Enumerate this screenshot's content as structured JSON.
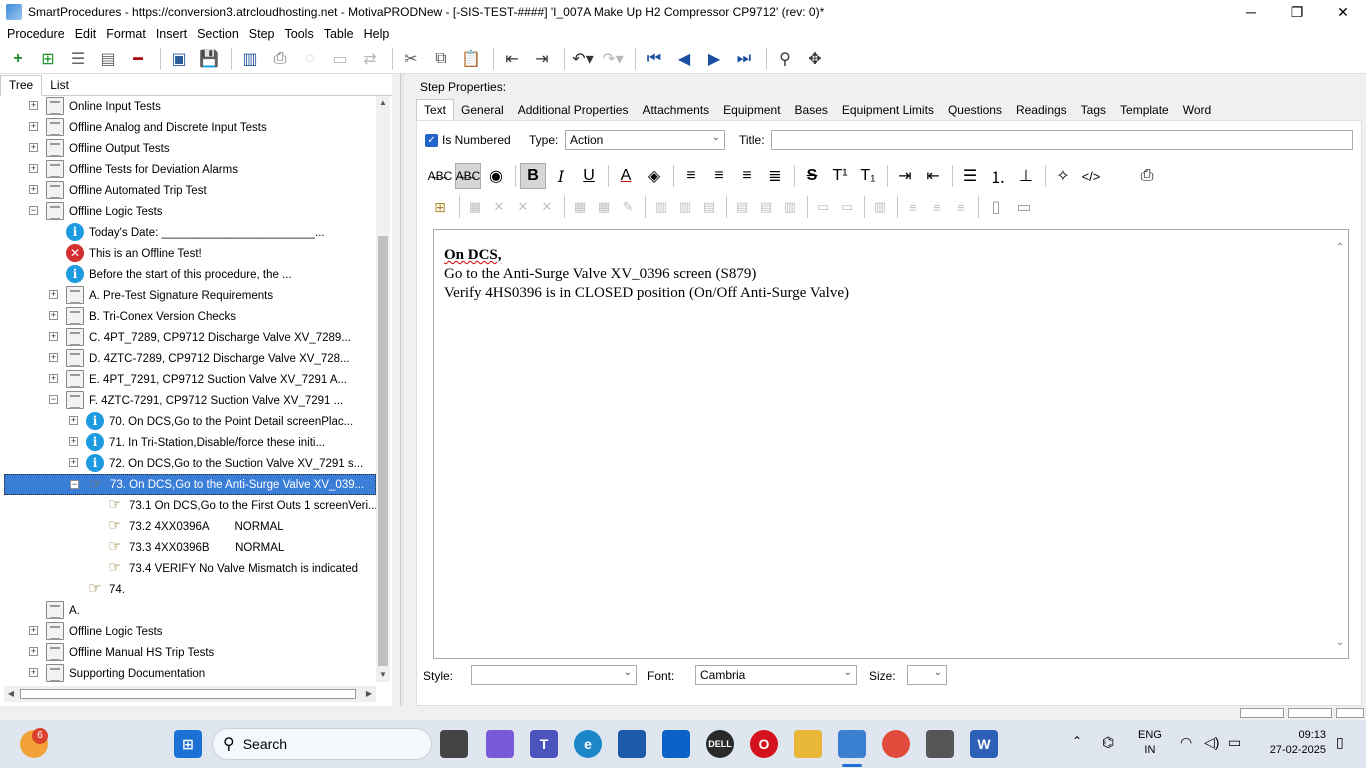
{
  "window": {
    "title": "SmartProcedures - https://conversion3.atrcloudhosting.net - MotivaPRODNew - [-SIS-TEST-####] 'I_007A Make Up H2 Compressor CP9712' (rev: 0)*",
    "minimize": "─",
    "maximize": "❐",
    "close": "✕"
  },
  "menu": [
    "Procedure",
    "Edit",
    "Format",
    "Insert",
    "Section",
    "Step",
    "Tools",
    "Table",
    "Help"
  ],
  "left_tabs": [
    "Tree",
    "List"
  ],
  "tree": [
    {
      "label": "Online Input Tests",
      "icon": "doc",
      "exp": "+",
      "level": 0
    },
    {
      "label": "Offline Analog and Discrete Input Tests",
      "icon": "doc",
      "exp": "+",
      "level": 0
    },
    {
      "label": "Offline Output Tests",
      "icon": "doc",
      "exp": "+",
      "level": 0
    },
    {
      "label": "Offline Tests for Deviation Alarms",
      "icon": "doc",
      "exp": "+",
      "level": 0
    },
    {
      "label": "Offline Automated Trip Test",
      "icon": "doc",
      "exp": "+",
      "level": 0
    },
    {
      "label": "Offline Logic Tests",
      "icon": "doc",
      "exp": "−",
      "level": 0
    },
    {
      "label": "Today's Date: ________________________...",
      "icon": "info",
      "exp": "",
      "level": 1
    },
    {
      "label": "This is an Offline Test!",
      "icon": "err",
      "exp": "",
      "level": 1
    },
    {
      "label": "Before the start of this procedure, the ...",
      "icon": "info",
      "exp": "",
      "level": 1
    },
    {
      "label": "A. Pre-Test Signature Requirements",
      "icon": "doc",
      "exp": "+",
      "level": 1
    },
    {
      "label": "B. Tri-Conex Version Checks",
      "icon": "doc",
      "exp": "+",
      "level": 1
    },
    {
      "label": "C. 4PT_7289, CP9712 Discharge Valve XV_7289...",
      "icon": "doc",
      "exp": "+",
      "level": 1
    },
    {
      "label": "D. 4ZTC-7289, CP9712 Discharge Valve XV_728...",
      "icon": "doc",
      "exp": "+",
      "level": 1
    },
    {
      "label": "E. 4PT_7291, CP9712 Suction Valve XV_7291 A...",
      "icon": "doc",
      "exp": "+",
      "level": 1
    },
    {
      "label": "F. 4ZTC-7291, CP9712 Suction Valve XV_7291 ...",
      "icon": "doc",
      "exp": "−",
      "level": 1
    },
    {
      "label": "70. On DCS,Go to the Point Detail screenPlac...",
      "icon": "info",
      "exp": "+",
      "level": 2
    },
    {
      "label": "71. In Tri-Station,Disable/force these initi...",
      "icon": "info",
      "exp": "+",
      "level": 2
    },
    {
      "label": "72. On DCS,Go to the Suction Valve XV_7291 s...",
      "icon": "info",
      "exp": "+",
      "level": 2
    },
    {
      "label": "73. On DCS,Go to the Anti-Surge Valve XV_039...",
      "icon": "hand",
      "exp": "−",
      "level": 2,
      "selected": true
    },
    {
      "label": "73.1 On DCS,Go to the First Outs 1 screenVeri...",
      "icon": "hand",
      "exp": "",
      "level": 3
    },
    {
      "label": "73.2 4XX0396A        NORMAL",
      "icon": "hand",
      "exp": "",
      "level": 3
    },
    {
      "label": "73.3 4XX0396B        NORMAL",
      "icon": "hand",
      "exp": "",
      "level": 3
    },
    {
      "label": "73.4 VERIFY No Valve Mismatch is indicated",
      "icon": "hand",
      "exp": "",
      "level": 3
    },
    {
      "label": "74.",
      "icon": "hand",
      "exp": "",
      "level": 2
    },
    {
      "label": "A.",
      "icon": "doc",
      "exp": "",
      "level": 0
    },
    {
      "label": "Offline Logic Tests",
      "icon": "doc",
      "exp": "+",
      "level": 0
    },
    {
      "label": "Offline Manual HS Trip Tests",
      "icon": "doc",
      "exp": "+",
      "level": 0
    },
    {
      "label": "Supporting Documentation",
      "icon": "doc",
      "exp": "+",
      "level": 0
    }
  ],
  "step_props": {
    "heading": "Step Properties:",
    "tabs": [
      "Text",
      "General",
      "Additional Properties",
      "Attachments",
      "Equipment",
      "Bases",
      "Equipment Limits",
      "Questions",
      "Readings",
      "Tags",
      "Template",
      "Word"
    ],
    "is_numbered_label": "Is Numbered",
    "type_label": "Type:",
    "type_value": "Action",
    "title_label": "Title:",
    "title_value": ""
  },
  "editor": {
    "line1": "On DCS,",
    "line2": "Go to the Anti-Surge Valve XV_0396 screen (S879)",
    "line3": "Verify 4HS0396 is in CLOSED position (On/Off Anti-Surge Valve)"
  },
  "format_row": {
    "style_label": "Style:",
    "style_value": "",
    "font_label": "Font:",
    "font_value": "Cambria",
    "size_label": "Size:",
    "size_value": ""
  },
  "taskbar": {
    "search_placeholder": "Search",
    "notif_count": "6",
    "lang_top": "ENG",
    "lang_bottom": "IN",
    "time": "09:13",
    "date": "27-02-2025"
  }
}
